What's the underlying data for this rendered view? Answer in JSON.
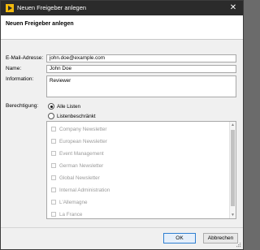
{
  "window": {
    "title": "Neuen Freigeber anlegen",
    "close_symbol": "✕",
    "icon": "app-icon",
    "accent": "#f2b90c"
  },
  "header": {
    "title": "Neuen Freigeber anlegen"
  },
  "form": {
    "email_label": "E-Mail-Adresse:",
    "email_value": "john.doe@example.com",
    "name_label": "Name:",
    "name_value": "John Doe",
    "info_label": "Information:",
    "info_value": "Reviewer",
    "permission_label": "Berechtigung:",
    "radio_all_label": "Alle Listen",
    "radio_restricted_label": "Listenbeschränkt",
    "selected_radio": "Alle Listen"
  },
  "lists": {
    "items": [
      "Company Newsletter",
      "European Newsletter",
      "Event Management",
      "German Newsletter",
      "Global Newsletter",
      "Internal Administration",
      "L'Allemagne",
      "La France"
    ]
  },
  "buttons": {
    "ok": "OK",
    "cancel": "Abbrechen"
  }
}
